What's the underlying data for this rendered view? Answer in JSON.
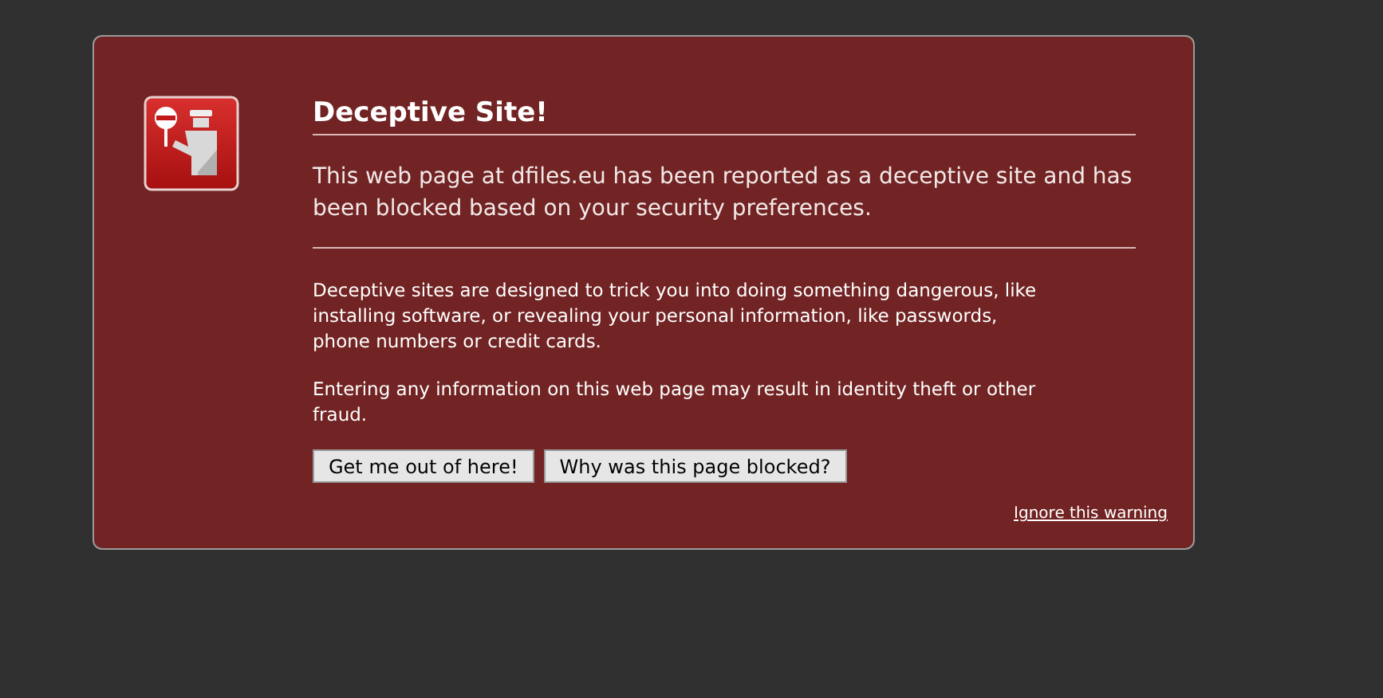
{
  "title": "Deceptive Site!",
  "summary": "This web page at dfiles.eu has been reported as a deceptive site and has been blocked based on your security preferences.",
  "details": [
    "Deceptive sites are designed to trick you into doing something dangerous, like installing software, or revealing your personal information, like passwords, phone numbers or credit cards.",
    "Entering any information on this web page may result in identity theft or other fraud."
  ],
  "buttons": [
    "Get me out of here!",
    "Why was this page blocked?"
  ],
  "link": "Ignore this warning"
}
